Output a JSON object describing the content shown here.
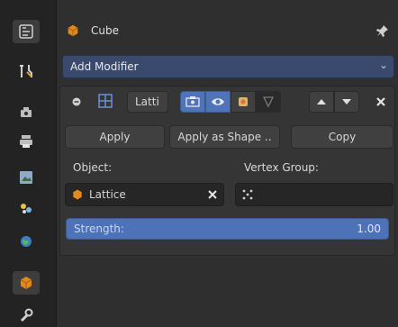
{
  "panel": {
    "title": "Cube"
  },
  "add_modifier": {
    "label": "Add Modifier"
  },
  "modifier": {
    "name": "Latti",
    "apply_label": "Apply",
    "apply_shape_label": "Apply as Shape ..",
    "copy_label": "Copy",
    "object_label": "Object:",
    "vertex_group_label": "Vertex Group:",
    "object_value": "Lattice",
    "strength_label": "Strength:",
    "strength_value": "1.00"
  },
  "colors": {
    "accent": "#4f74b8",
    "object_orange": "#e08a1e"
  },
  "icons": [
    "tool-icon",
    "wrench-screwdriver-icon",
    "render-icon",
    "output-icon",
    "view-layer-icon",
    "scene-icon",
    "world-icon",
    "object-icon",
    "modifier-wrench-icon",
    "cube-icon",
    "pin-icon",
    "collapse-icon",
    "lattice-icon",
    "editmode-icon",
    "eye-icon",
    "render-toggle-icon",
    "cage-icon",
    "move-up-icon",
    "move-down-icon",
    "remove-icon",
    "vertex-group-icon"
  ]
}
